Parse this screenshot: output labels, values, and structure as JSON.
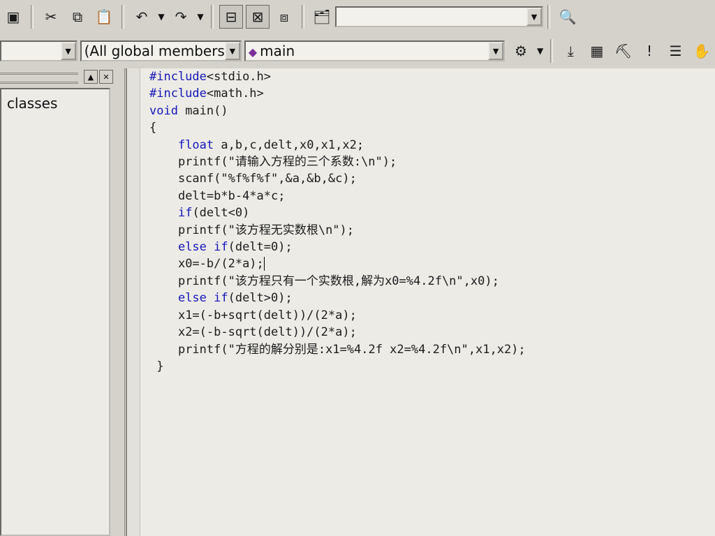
{
  "toolbar1": {
    "icons": [
      "workspace-icon",
      "cut-icon",
      "copy-icon",
      "paste-icon",
      "undo-icon",
      "redo-icon",
      "output-window-icon",
      "debug-window-icon",
      "window-list-icon",
      "find-in-files-icon",
      "find-icon"
    ],
    "find_value": ""
  },
  "toolbar2": {
    "class_combo": "",
    "filter_combo": "(All global members",
    "member_combo": "main",
    "icons": [
      "wizard-bar-icon",
      "compile-icon",
      "build-icon",
      "stop-build-icon",
      "execute-icon",
      "step-icon",
      "breakpoint-hand-icon"
    ]
  },
  "left_panel": {
    "tree_item": "classes"
  },
  "code": {
    "lines": [
      {
        "kw": "#include",
        "rest": "<stdio.h>",
        "indent": 0
      },
      {
        "kw": "#include",
        "rest": "<math.h>",
        "indent": 0
      },
      {
        "kw": "void",
        "rest": " main()",
        "indent": 0
      },
      {
        "kw": "",
        "rest": "{",
        "indent": 0
      },
      {
        "kw": "float",
        "rest": " a,b,c,delt,x0,x1,x2;",
        "indent": 4
      },
      {
        "kw": "",
        "rest": "printf(\"请输入方程的三个系数:\\n\");",
        "indent": 4
      },
      {
        "kw": "",
        "rest": "scanf(\"%f%f%f\",&a,&b,&c);",
        "indent": 4
      },
      {
        "kw": "",
        "rest": "delt=b*b-4*a*c;",
        "indent": 4
      },
      {
        "kw": "if",
        "rest": "(delt<0)",
        "indent": 4
      },
      {
        "kw": "",
        "rest": "printf(\"该方程无实数根\\n\");",
        "indent": 4
      },
      {
        "kw": "else if",
        "rest": "(delt=0);",
        "indent": 4
      },
      {
        "kw": "",
        "rest": "x0=-b/(2*a);",
        "indent": 4,
        "caret": true
      },
      {
        "kw": "",
        "rest": "printf(\"该方程只有一个实数根,解为x0=%4.2f\\n\",x0);",
        "indent": 4
      },
      {
        "kw": "else if",
        "rest": "(delt>0);",
        "indent": 4
      },
      {
        "kw": "",
        "rest": "x1=(-b+sqrt(delt))/(2*a);",
        "indent": 4
      },
      {
        "kw": "",
        "rest": "x2=(-b-sqrt(delt))/(2*a);",
        "indent": 4
      },
      {
        "kw": "",
        "rest": "printf(\"方程的解分别是:x1=%4.2f x2=%4.2f\\n\",x1,x2);",
        "indent": 4
      },
      {
        "kw": "",
        "rest": "}",
        "indent": 1
      }
    ]
  }
}
